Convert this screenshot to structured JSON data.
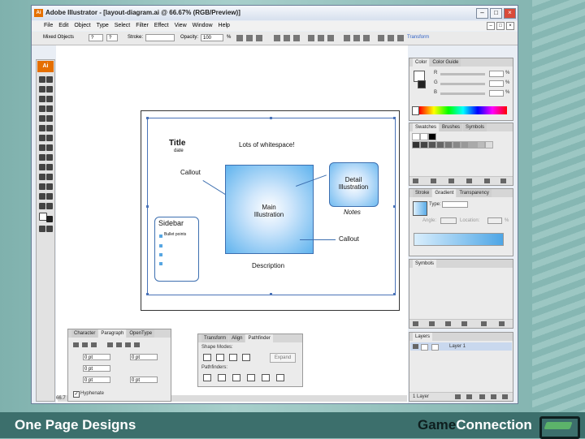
{
  "window": {
    "title": "Adobe Illustrator - [layout-diagram.ai @ 66.67% (RGB/Preview)]",
    "app_icon_label": "Ai"
  },
  "menus": [
    "File",
    "Edit",
    "Object",
    "Type",
    "Select",
    "Filter",
    "Effect",
    "View",
    "Window",
    "Help"
  ],
  "control_bar": {
    "selection_label": "Mixed Objects",
    "stroke_label": "Stroke:",
    "opacity_label": "Opacity:",
    "opacity_value": "100",
    "opacity_unit": "%",
    "transform_link": "Transform"
  },
  "toolbox": {
    "logo": "Ai"
  },
  "artboard": {
    "title": "Title",
    "date": "date",
    "whitespace": "Lots of whitespace!",
    "callout_top": "Callout",
    "main": "Main Illustration",
    "detail": "Detail Illustration",
    "notes": "Notes",
    "callout_right": "Callout",
    "sidebar": "Sidebar",
    "bullets": "Bullet points",
    "description": "Description"
  },
  "color_panel": {
    "tabs": [
      "Color",
      "Color Guide"
    ],
    "labels": [
      "R",
      "G",
      "B"
    ],
    "units": [
      "%",
      "%",
      "%"
    ]
  },
  "swatches_panel": {
    "tabs": [
      "Swatches",
      "Brushes",
      "Symbols"
    ]
  },
  "gradient_panel": {
    "tabs": [
      "Stroke",
      "Gradient",
      "Transparency"
    ],
    "type_label": "Type:",
    "angle_label": "Angle:",
    "location_label": "Location:",
    "unit": "%"
  },
  "symbols_panel": {
    "tabs": [
      "Symbols"
    ]
  },
  "layers_panel": {
    "tabs": [
      "Layers"
    ],
    "layer_name": "Layer 1",
    "footer": "1 Layer"
  },
  "character_panel": {
    "tabs": [
      "Character",
      "Paragraph",
      "OpenType"
    ],
    "fields": [
      "0 pt",
      "0 pt",
      "0 pt",
      "0 pt",
      "0 pt"
    ],
    "hyphenate": "Hyphenate"
  },
  "pathfinder_panel": {
    "tabs": [
      "Transform",
      "Align",
      "Pathfinder"
    ],
    "shape_modes": "Shape Modes:",
    "expand": "Expand",
    "pathfinders": "Pathfinders:"
  },
  "status": {
    "zoom": "66.7"
  },
  "footer": {
    "left": "One Page Designs",
    "right_dark": "Game",
    "right_light": "Connection"
  }
}
